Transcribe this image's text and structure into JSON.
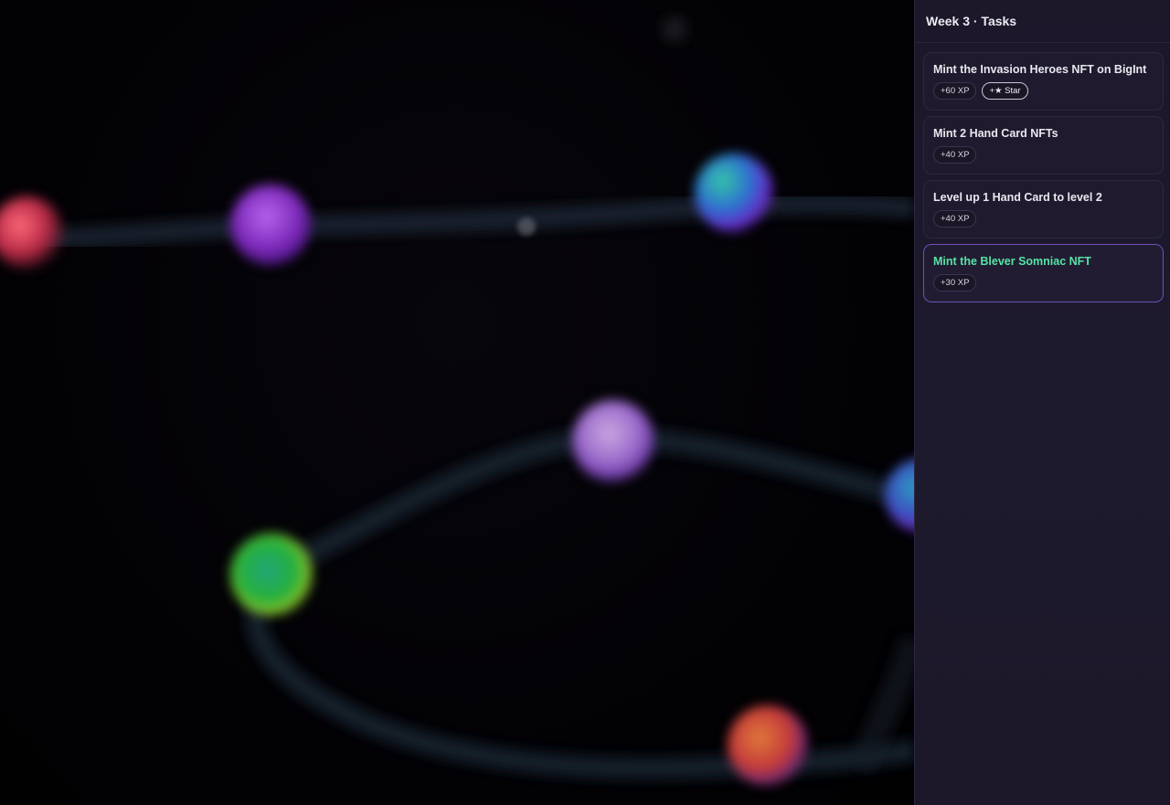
{
  "panel": {
    "title": "Week 3 · Tasks",
    "tasks": [
      {
        "title": "Mint the Invasion Heroes NFT on BigInt",
        "xp": "+60 XP",
        "extra": "+★ Star",
        "active": false
      },
      {
        "title": "Mint 2 Hand Card NFTs",
        "xp": "+40 XP",
        "active": false
      },
      {
        "title": "Level up 1 Hand Card to level 2",
        "xp": "+40 XP",
        "active": false
      },
      {
        "title": "Mint the Blever Somniac NFT",
        "xp": "+30 XP",
        "active": true
      }
    ]
  },
  "colors": {
    "panel_bg": "#1e1a2e",
    "active_title": "#57e3a4",
    "active_border": "#6f52b6",
    "path_glow": "#1c2633"
  },
  "map": {
    "nodes": [
      {
        "name": "pink-red-node",
        "color": "#d8364e"
      },
      {
        "name": "purple-node",
        "color": "#8a2fc4"
      },
      {
        "name": "teal-blue-node",
        "color": "#3a77c0"
      },
      {
        "name": "lavender-node",
        "color": "#a77ac9"
      },
      {
        "name": "cyan-purple-node",
        "color": "#2a7aa0"
      },
      {
        "name": "green-node",
        "color": "#2fa33f"
      },
      {
        "name": "orange-node",
        "color": "#d05a2a"
      }
    ]
  }
}
